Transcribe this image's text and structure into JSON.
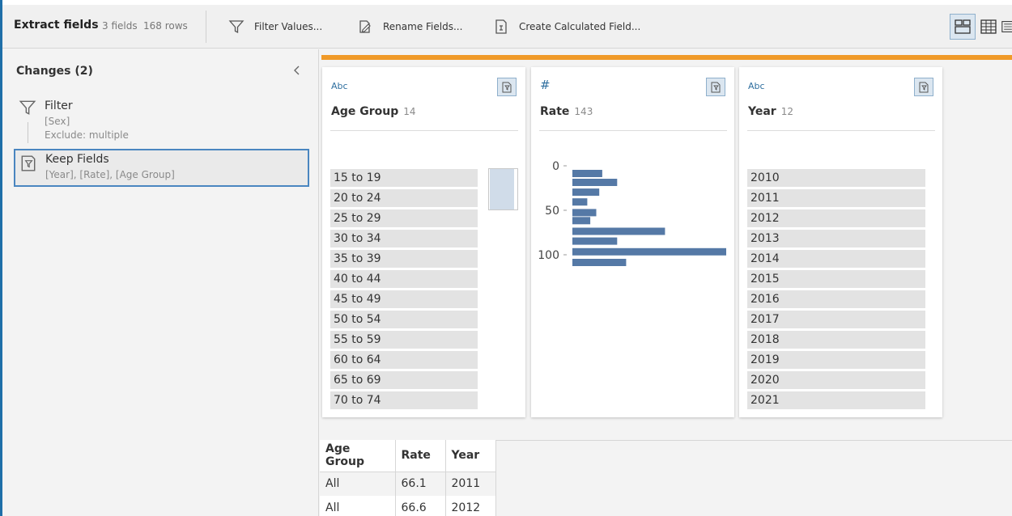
{
  "toolbar": {
    "title": "Extract fields",
    "fields_count": "3 fields",
    "rows_count": "168 rows",
    "filter_label": "Filter Values...",
    "rename_label": "Rename Fields...",
    "calc_label": "Create Calculated Field..."
  },
  "changes": {
    "title": "Changes (2)",
    "items": [
      {
        "name": "Filter",
        "sub1": "[Sex]",
        "sub2": "Exclude: multiple",
        "icon": "filter-icon"
      },
      {
        "name": "Keep Fields",
        "sub1": "[Year], [Rate], [Age Group]",
        "icon": "keep-fields-icon"
      }
    ]
  },
  "cards": [
    {
      "type": "Abc",
      "name": "Age Group",
      "count": "14",
      "values": [
        "15 to 19",
        "20 to 24",
        "25 to 29",
        "30 to 34",
        "35 to 39",
        "40 to 44",
        "45 to 49",
        "50 to 54",
        "55 to 59",
        "60 to 64",
        "65 to 69",
        "70 to 74"
      ]
    },
    {
      "type": "#",
      "name": "Rate",
      "count": "143"
    },
    {
      "type": "Abc",
      "name": "Year",
      "count": "12",
      "values": [
        "2010",
        "2011",
        "2012",
        "2013",
        "2014",
        "2015",
        "2016",
        "2017",
        "2018",
        "2019",
        "2020",
        "2021"
      ]
    }
  ],
  "chart_data": {
    "type": "bar",
    "orientation": "horizontal",
    "title": "",
    "xlabel": "",
    "ylabel": "",
    "y_ticks": [
      "0",
      "50",
      "100"
    ],
    "ylim": [
      0,
      110
    ],
    "bins": [
      0,
      8.5,
      17,
      25.5,
      34,
      42.5,
      51,
      59.5,
      68,
      76.5,
      85,
      93.5,
      102,
      110.5
    ],
    "counts": [
      20,
      30,
      18,
      10,
      16,
      12,
      62,
      30,
      103,
      36
    ],
    "bin_rows": [
      {
        "start": 0,
        "count": 20
      },
      {
        "start": 10,
        "count": 30
      },
      {
        "start": 21,
        "count": 18
      },
      {
        "start": 32,
        "count": 10
      },
      {
        "start": 44,
        "count": 16
      },
      {
        "start": 53,
        "count": 12
      },
      {
        "start": 65,
        "count": 62
      },
      {
        "start": 76,
        "count": 30
      },
      {
        "start": 88,
        "count": 103
      },
      {
        "start": 100,
        "count": 36
      }
    ],
    "bar_color": "#5579a6",
    "grid": false
  },
  "table": {
    "headers": [
      "Age Group",
      "Rate",
      "Year"
    ],
    "rows": [
      [
        "All",
        "66.1",
        "2011"
      ],
      [
        "All",
        "66.6",
        "2012"
      ]
    ]
  },
  "colors": {
    "accent_orange": "#f09a28",
    "selection_blue": "#4a86c0",
    "type_blue": "#2f6f9f",
    "bar_blue": "#5579a6"
  }
}
